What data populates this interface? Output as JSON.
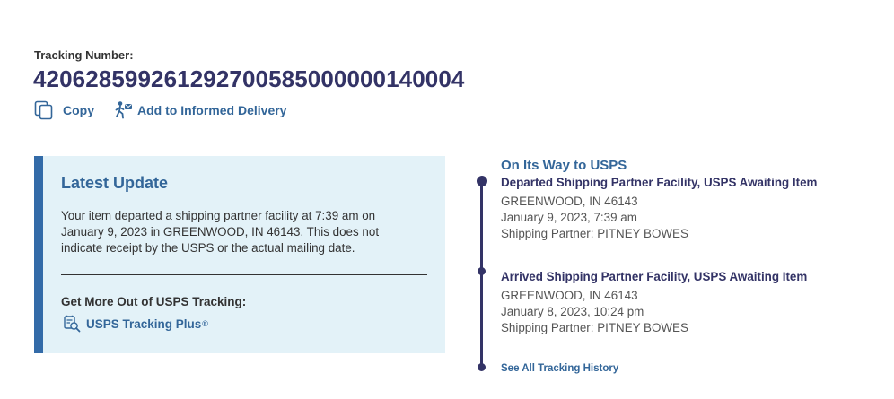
{
  "header": {
    "tracking_label": "Tracking Number:",
    "tracking_number": "420628599261292700585000000140004"
  },
  "actions": {
    "copy_label": "Copy",
    "informed_label": "Add to Informed Delivery"
  },
  "latest_update": {
    "title": "Latest Update",
    "text": "Your item departed a shipping partner facility at 7:39 am on January 9, 2023 in GREENWOOD, IN 46143. This does not indicate receipt by the USPS or the actual mailing date.",
    "more_title": "Get More Out of USPS Tracking:",
    "plus_label": "USPS Tracking Plus",
    "plus_mark": "®"
  },
  "timeline": {
    "status": "On Its Way to USPS",
    "events": [
      {
        "title": "Departed Shipping Partner Facility, USPS Awaiting Item",
        "location": "GREENWOOD, IN 46143",
        "datetime": "January 9, 2023, 7:39 am",
        "partner": "Shipping Partner: PITNEY BOWES"
      },
      {
        "title": "Arrived Shipping Partner Facility, USPS Awaiting Item",
        "location": "GREENWOOD, IN 46143",
        "datetime": "January 8, 2023, 10:24 pm",
        "partner": "Shipping Partner: PITNEY BOWES"
      }
    ],
    "history_link": "See All Tracking History"
  },
  "colors": {
    "navy": "#333366",
    "link_blue": "#336699",
    "card_bg": "#e3f2f8",
    "card_accent": "#336ba8"
  },
  "icons": {
    "copy": "copy-icon",
    "informed": "informed-delivery-icon",
    "plus": "tracking-plus-icon"
  }
}
